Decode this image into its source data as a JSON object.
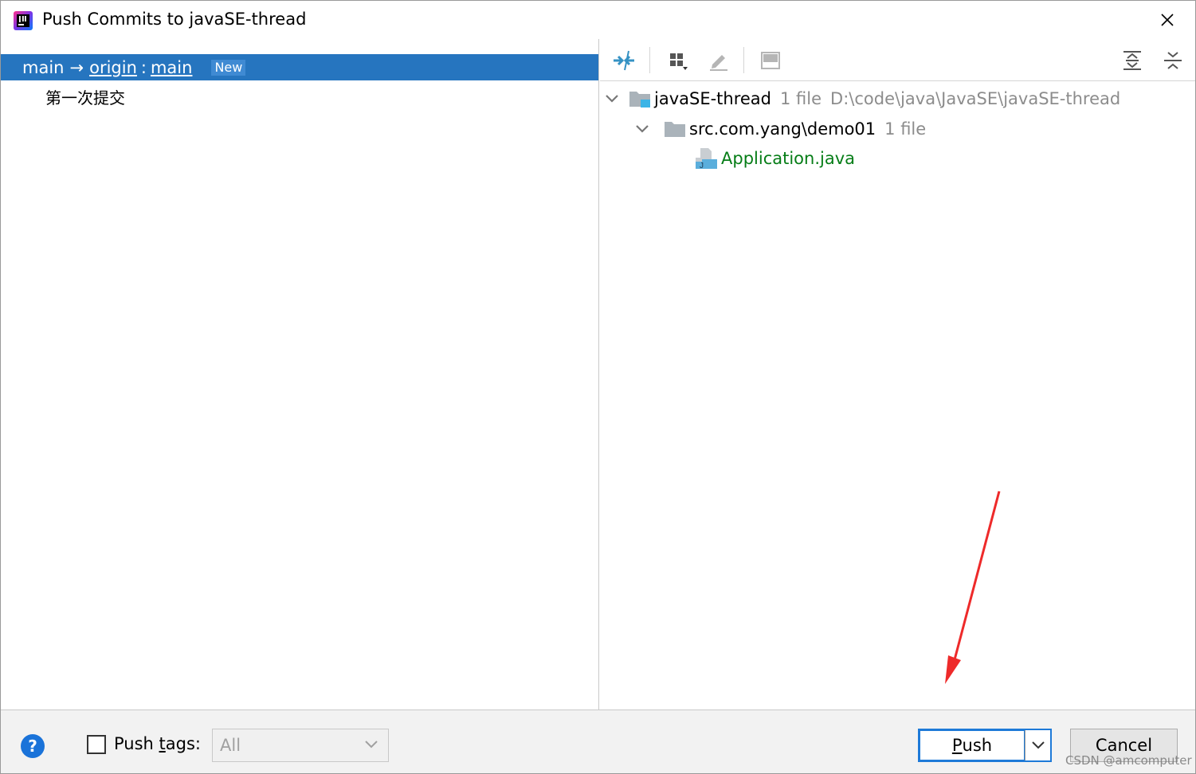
{
  "window": {
    "title": "Push Commits to javaSE-thread"
  },
  "left": {
    "branch": {
      "local": "main",
      "arrow": "→",
      "remote": "origin",
      "separator": ":",
      "remote_branch": "main",
      "badge": "New"
    },
    "commits": [
      {
        "message": "第一次提交"
      }
    ]
  },
  "right": {
    "toolbar": [
      "expand-collapse-icon",
      "group-by-icon",
      "edit-source-icon",
      "preview-diff-icon",
      "expand-all-icon",
      "collapse-all-icon"
    ],
    "tree": {
      "root": {
        "name": "javaSE-thread",
        "count": "1 file",
        "path": "D:\\code\\java\\JavaSE\\javaSE-thread"
      },
      "folder": {
        "name": "src.com.yang\\demo01",
        "count": "1 file"
      },
      "file": {
        "name": "Application.java"
      }
    }
  },
  "bottom": {
    "help": "?",
    "push_tags_pre": "Push ",
    "push_tags_mnemonic": "t",
    "push_tags_post": "ags:",
    "tags_select_value": "All",
    "push_mnemonic": "P",
    "push_rest": "ush",
    "cancel_label": "Cancel"
  },
  "watermark": "CSDN @amcomputer",
  "colors": {
    "selection": "#2675bf",
    "file_added": "#067d17",
    "focus_border": "#1e7ad8",
    "annotation": "#ee2a2a"
  }
}
